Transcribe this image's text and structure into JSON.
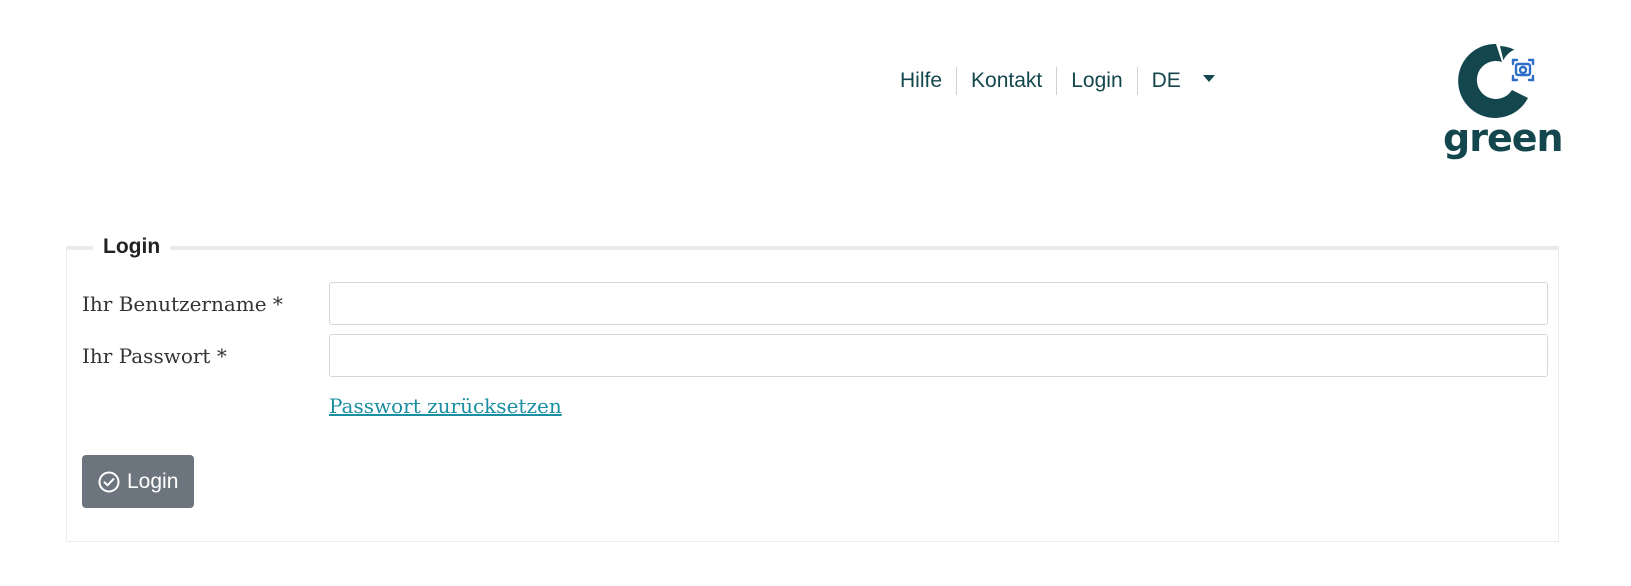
{
  "header": {
    "nav": {
      "help": "Hilfe",
      "contact": "Kontakt",
      "login": "Login",
      "language": "DE"
    },
    "logo": {
      "text": "green",
      "icon": "camera-icon",
      "brand_color": "#14474d"
    }
  },
  "login_form": {
    "legend": "Login",
    "username": {
      "label": "Ihr Benutzername *",
      "value": "",
      "placeholder": ""
    },
    "password": {
      "label": "Ihr Passwort *",
      "value": "",
      "placeholder": ""
    },
    "reset_link": "Passwort zurücksetzen",
    "submit": {
      "label": "Login",
      "icon": "check-circle-icon",
      "color": "#6c757d"
    }
  },
  "colors": {
    "link": "#1a8fa1",
    "nav_text": "#14474d"
  }
}
